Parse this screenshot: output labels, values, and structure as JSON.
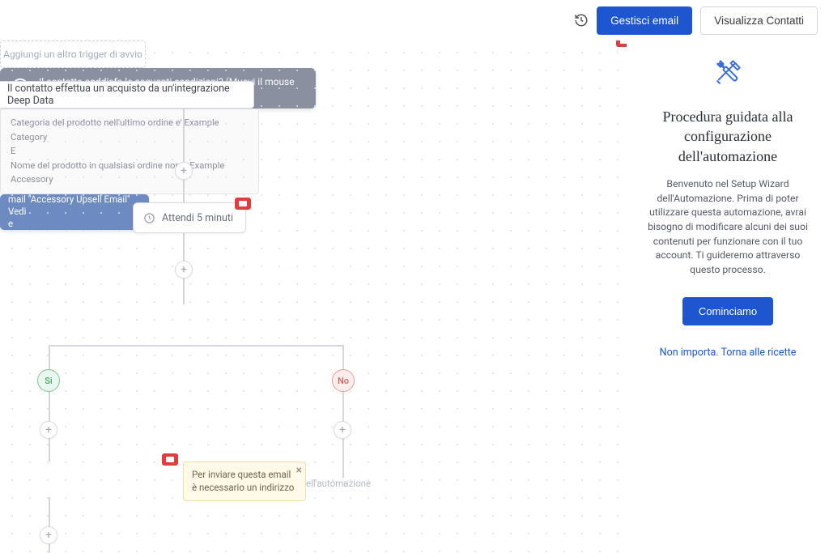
{
  "topbar": {
    "manage_emails": "Gestisci email",
    "view_contacts": "Visualizza Contatti"
  },
  "flow": {
    "trigger": "Il contatto effettua un acquisto da un'integrazione Deep Data",
    "add_trigger": "Aggiungi un altro trigger di avvio",
    "wait": "Attendi 5 minuti",
    "condition_text": "Il contatto soddisfa le seguenti condizioni? (Muovi il mouse sul segmento per visualizzarne i dettagli.)",
    "detail_line1": "Categoria del prodotto nell'ultimo ordine e' Example Category",
    "detail_and": "E",
    "detail_line2": "Nome del prodotto in qualsiasi ordine non è Example Accessory",
    "branch_yes": "Si",
    "branch_no": "No",
    "email_action": "mail \"Accessory Upsell Email\" Vedi",
    "email_action_line2": "e",
    "tooltip": "Per inviare questa email è necessario un indirizzo",
    "end_label": "ell'automazione"
  },
  "wizard": {
    "title": "Procedura guidata alla configurazione dell'automazione",
    "description": "Benvenuto nel Setup Wizard dell'Automazione. Prima di poter utilizzare questa automazione, avrai bisogno di modificare alcuni dei suoi contenuti per funzionare con il tuo account. Ti guideremo attraverso questo processo.",
    "start_button": "Cominciamo",
    "skip_link": "Non importa. Torna alle ricette"
  }
}
